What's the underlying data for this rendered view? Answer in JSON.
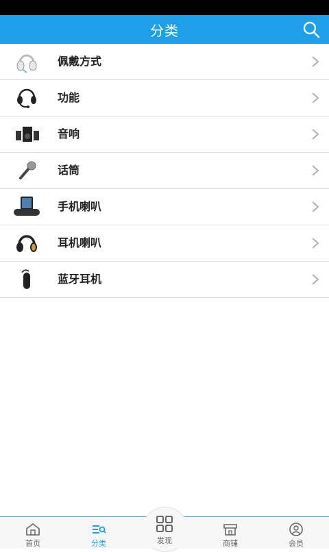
{
  "header": {
    "title": "分类",
    "search_icon": "search-icon"
  },
  "categories": [
    {
      "label": "佩戴方式",
      "icon": "headphones-white-thumb"
    },
    {
      "label": "功能",
      "icon": "headset-mic-thumb"
    },
    {
      "label": "音响",
      "icon": "speaker-set-thumb"
    },
    {
      "label": "话筒",
      "icon": "microphone-thumb"
    },
    {
      "label": "手机喇叭",
      "icon": "dock-speaker-thumb"
    },
    {
      "label": "耳机喇叭",
      "icon": "headphones-black-thumb"
    },
    {
      "label": "蓝牙耳机",
      "icon": "bluetooth-earpiece-thumb"
    }
  ],
  "tabs": [
    {
      "label": "首页",
      "icon": "home-icon"
    },
    {
      "label": "分类",
      "icon": "category-list-icon",
      "active": true
    },
    {
      "label": "发现",
      "icon": "grid-icon"
    },
    {
      "label": "商铺",
      "icon": "store-icon"
    },
    {
      "label": "会员",
      "icon": "user-icon"
    }
  ],
  "colors": {
    "accent": "#1da0e9",
    "statusbar": "#000000"
  }
}
